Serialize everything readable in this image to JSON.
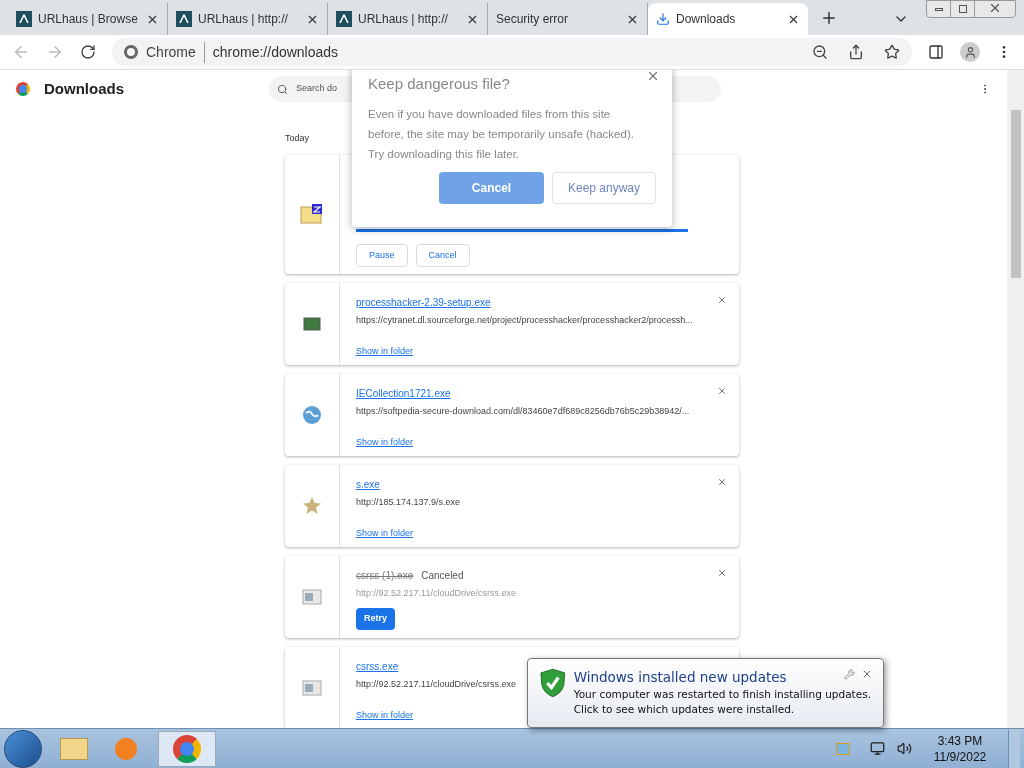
{
  "tabs": [
    {
      "title": "URLhaus | Browse",
      "selected": false
    },
    {
      "title": "URLhaus | http://",
      "selected": false
    },
    {
      "title": "URLhaus | http://",
      "selected": false
    },
    {
      "title": "Security error",
      "selected": false
    },
    {
      "title": "Downloads",
      "selected": true
    }
  ],
  "address": {
    "site": "Chrome",
    "url": "chrome://downloads"
  },
  "page": {
    "title": "Downloads",
    "search": {
      "placeholder": "Search do"
    },
    "section": "Today"
  },
  "dialog": {
    "title": "Keep dangerous file?",
    "body": "Even if you have downloaded files from this site before, the site may be temporarily unsafe (hacked). Try downloading this file later.",
    "buttons": [
      {
        "label": "Cancel",
        "kind": "primary"
      },
      {
        "label": "Keep anyway",
        "kind": "secondary"
      }
    ]
  },
  "downloads": [
    {
      "kind": "progress",
      "level": 1,
      "actions": [
        "Pause",
        "Cancel"
      ]
    },
    {
      "kind": "done",
      "file": "processhacker-2.39-setup.exe",
      "url": "https://cytranet.dl.sourceforge.net/project/processhacker/processhacker2/processh...",
      "link": "Show in folder"
    },
    {
      "kind": "done",
      "file": "IECollection1721.exe",
      "url": "https://softpedia-secure-download.com/dl/83460e7df689c8256db76b5c29b38942/...",
      "link": "Show in folder"
    },
    {
      "kind": "done",
      "file": "s.exe",
      "url": "http://185.174.137.9/s.exe",
      "link": "Show in folder"
    },
    {
      "kind": "canceled",
      "file": "csrss (1).exe",
      "status": "Canceled",
      "url": "http://92.52.217.11/cloudDrive/csrss.exe",
      "actions": [
        "Retry"
      ]
    },
    {
      "kind": "done",
      "file": "csrss.exe",
      "url": "http://92.52.217.11/cloudDrive/csrss.exe",
      "link": "Show in folder"
    }
  ],
  "notification": {
    "title": "Windows installed new updates",
    "lines": [
      "Your computer was restarted to finish installing updates.",
      "Click to see which updates were installed."
    ]
  },
  "clock": {
    "time": "3:43 PM",
    "date": "11/9/2022"
  }
}
